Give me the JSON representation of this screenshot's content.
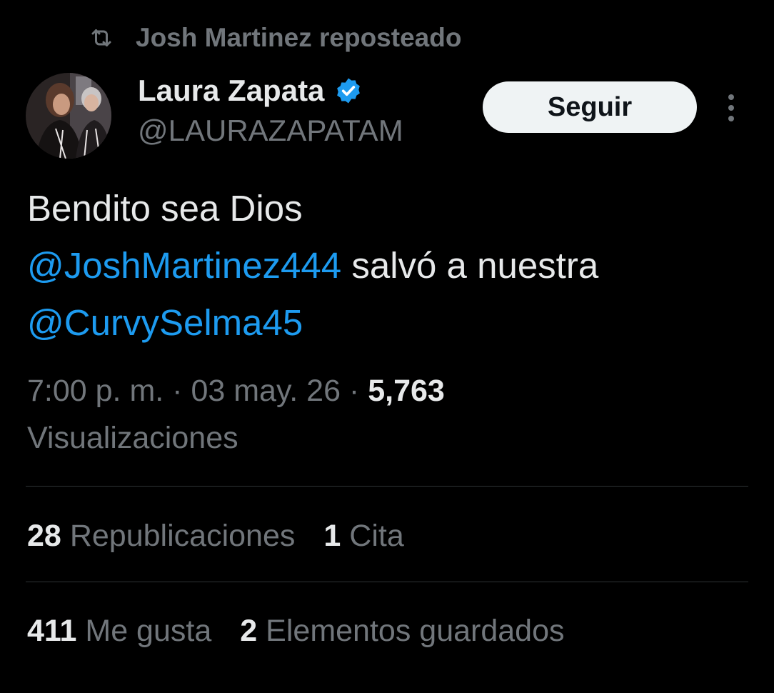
{
  "repost": {
    "icon": "repost-icon",
    "text": "Josh Martinez reposteado"
  },
  "author": {
    "avatar_icon": "avatar",
    "name": "Laura Zapata",
    "verified_icon": "verified-badge-icon",
    "handle": "@LAURAZAPATAM"
  },
  "actions": {
    "follow_label": "Seguir",
    "more_icon": "more-options-icon"
  },
  "tweet": {
    "line1": "Bendito sea Dios",
    "mention1": "@JoshMartinez444",
    "line2_rest": " salvó a nuestra",
    "mention2": "@CurvySelma45"
  },
  "meta": {
    "time": "7:00 p. m.",
    "separator": " · ",
    "date": "03 may. 26",
    "views_count": "5,763",
    "views_label": "Visualizaciones"
  },
  "stats": {
    "reposts_count": "28",
    "reposts_label": "Republicaciones",
    "quotes_count": "1",
    "quotes_label": "Cita",
    "likes_count": "411",
    "likes_label": "Me gusta",
    "bookmarks_count": "2",
    "bookmarks_label": "Elementos guardados"
  },
  "colors": {
    "background": "#000000",
    "text_primary": "#e7e9ea",
    "text_secondary": "#71767b",
    "accent": "#1d9bf0",
    "divider": "#2f3336",
    "button_bg": "#eff3f4"
  }
}
